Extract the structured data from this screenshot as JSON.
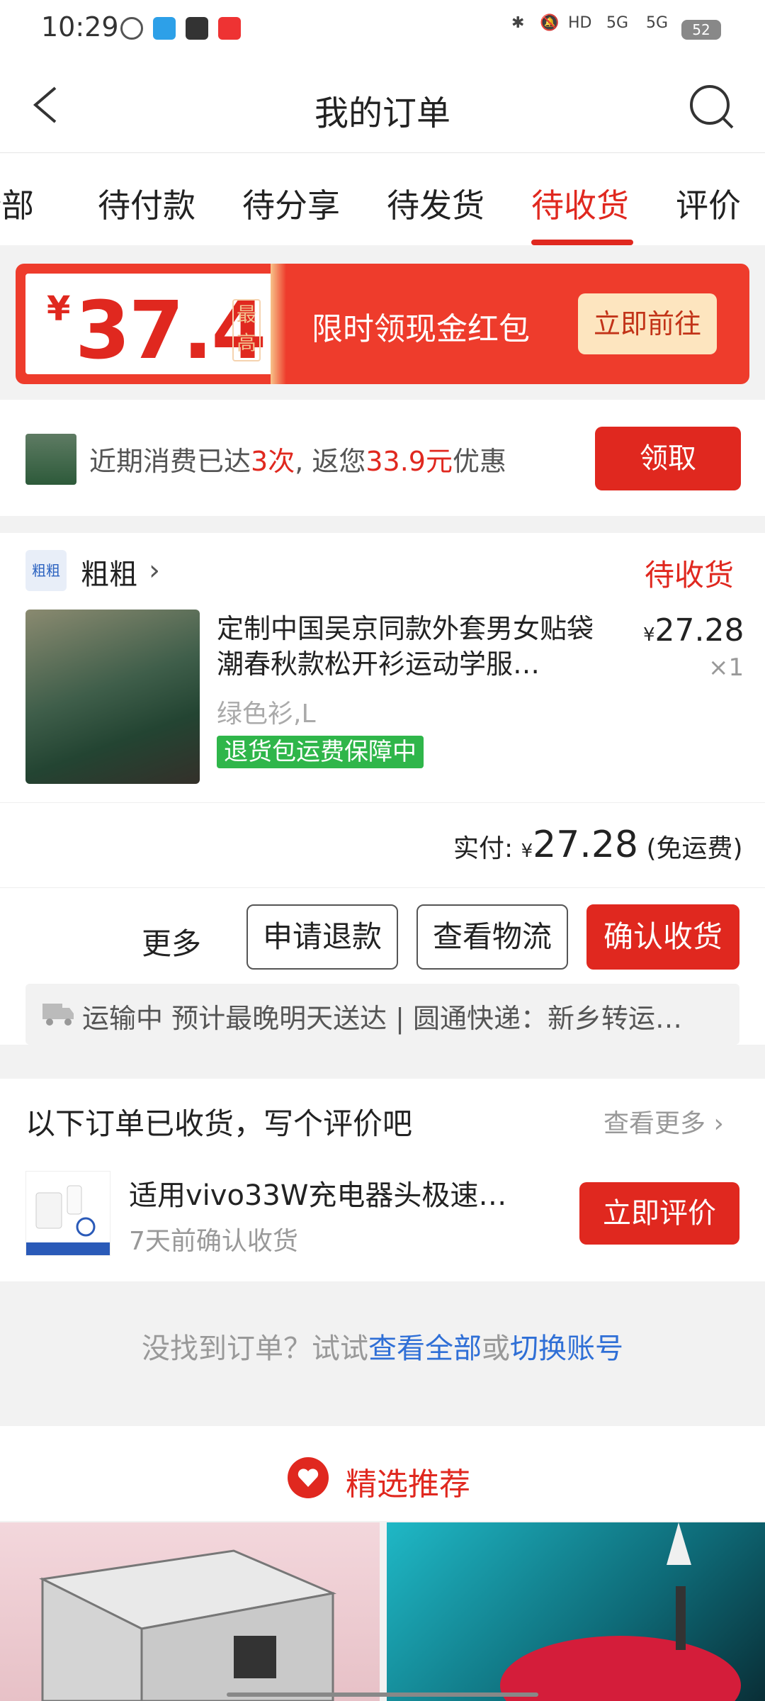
{
  "status_bar": {
    "time": "10:29",
    "battery": "52",
    "signal_1": "5G",
    "signal_2": "5G",
    "hd": "HD"
  },
  "header": {
    "title": "我的订单"
  },
  "tabs": [
    "全部",
    "待付款",
    "待分享",
    "待发货",
    "待收货",
    "评价"
  ],
  "active_tab": "待收货",
  "coupon": {
    "currency": "¥",
    "amount": "37.4",
    "badge": "最高",
    "text": "限时领现金红包",
    "button": "立即前往"
  },
  "promo": {
    "prefix": "近期消费已达",
    "count": "3次",
    "mid": ", 返您",
    "amount": "33.9元",
    "suffix": "优惠",
    "button": "领取"
  },
  "order": {
    "shop_icon_text": "粗粗",
    "shop_name": "粗粗",
    "status": "待收货",
    "product_title": "定制中国吴京同款外套男女贴袋潮春秋款松开衫运动学服…",
    "price_symbol": "¥",
    "price": "27.28",
    "quantity": "×1",
    "spec": "绿色衫,L",
    "tag": "退货包运费保障中",
    "paid_label": "实付:",
    "paid_symbol": "¥",
    "paid_amount": "27.28",
    "paid_note": "(免运费)",
    "more": "更多",
    "btn_refund": "申请退款",
    "btn_logistics": "查看物流",
    "btn_confirm": "确认收货",
    "shipping_text": "运输中 预计最晚明天送达 | 圆通快递：新乡转运…"
  },
  "review": {
    "heading": "以下订单已收货，写个评价吧",
    "more": "查看更多",
    "product_name": "适用vivo33W充电器头极速…",
    "time": "7天前确认收货",
    "button": "立即评价"
  },
  "not_found": {
    "text": "没找到订单？试试",
    "link1": "查看全部",
    "or": "或",
    "link2": "切换账号"
  },
  "recommend": {
    "title": "精选推荐"
  }
}
